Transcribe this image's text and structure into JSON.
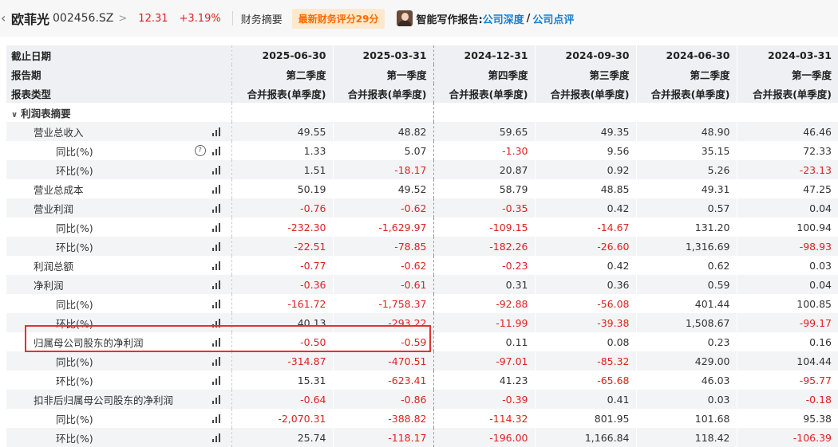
{
  "header": {
    "stock_name": "欧菲光",
    "stock_code": "002456.SZ",
    "chevron": ">",
    "price": "12.31",
    "change": "+3.19%",
    "tab_summary": "财务摘要",
    "score_badge": "最新财务评分29分",
    "report_label": "智能写作报告:",
    "report_link_1": "公司深度",
    "report_slash": "/",
    "report_link_2": "公司点评"
  },
  "table": {
    "header_labels": [
      "截止日期",
      "报告期",
      "报表类型"
    ],
    "columns": [
      {
        "date": "2025-06-30",
        "period": "第二季度",
        "type": "合并报表(单季度)"
      },
      {
        "date": "2025-03-31",
        "period": "第一季度",
        "type": "合并报表(单季度)"
      },
      {
        "date": "2024-12-31",
        "period": "第四季度",
        "type": "合并报表(单季度)"
      },
      {
        "date": "2024-09-30",
        "period": "第三季度",
        "type": "合并报表(单季度)"
      },
      {
        "date": "2024-06-30",
        "period": "第二季度",
        "type": "合并报表(单季度)"
      },
      {
        "date": "2024-03-31",
        "period": "第一季度",
        "type": "合并报表(单季度)"
      }
    ],
    "section_title": "利润表摘要",
    "rows": [
      {
        "label": "营业总收入",
        "values": [
          "49.55",
          "48.82",
          "59.65",
          "49.35",
          "48.90",
          "46.46"
        ]
      },
      {
        "label": "同比(%)",
        "values": [
          "1.33",
          "5.07",
          "-1.30",
          "9.56",
          "35.15",
          "72.33"
        ]
      },
      {
        "label": "环比(%)",
        "values": [
          "1.51",
          "-18.17",
          "20.87",
          "0.92",
          "5.26",
          "-23.13"
        ]
      },
      {
        "label": "营业总成本",
        "values": [
          "50.19",
          "49.52",
          "58.79",
          "48.85",
          "49.31",
          "47.25"
        ]
      },
      {
        "label": "营业利润",
        "values": [
          "-0.76",
          "-0.62",
          "-0.35",
          "0.42",
          "0.57",
          "0.04"
        ]
      },
      {
        "label": "同比(%)",
        "values": [
          "-232.30",
          "-1,629.97",
          "-109.15",
          "-14.67",
          "131.20",
          "100.94"
        ]
      },
      {
        "label": "环比(%)",
        "values": [
          "-22.51",
          "-78.85",
          "-182.26",
          "-26.60",
          "1,316.69",
          "-98.93"
        ]
      },
      {
        "label": "利润总额",
        "values": [
          "-0.77",
          "-0.62",
          "-0.23",
          "0.42",
          "0.62",
          "0.03"
        ]
      },
      {
        "label": "净利润",
        "values": [
          "-0.36",
          "-0.61",
          "0.31",
          "0.36",
          "0.59",
          "0.04"
        ]
      },
      {
        "label": "同比(%)",
        "values": [
          "-161.72",
          "-1,758.37",
          "-92.88",
          "-56.08",
          "401.44",
          "100.85"
        ]
      },
      {
        "label": "环比(%)",
        "values": [
          "40.13",
          "-293.22",
          "-11.99",
          "-39.38",
          "1,508.67",
          "-99.17"
        ]
      },
      {
        "label": "归属母公司股东的净利润",
        "values": [
          "-0.50",
          "-0.59",
          "0.11",
          "0.08",
          "0.23",
          "0.16"
        ]
      },
      {
        "label": "同比(%)",
        "values": [
          "-314.87",
          "-470.51",
          "-97.01",
          "-85.32",
          "429.00",
          "104.44"
        ]
      },
      {
        "label": "环比(%)",
        "values": [
          "15.31",
          "-623.41",
          "41.23",
          "-65.68",
          "46.03",
          "-95.77"
        ]
      },
      {
        "label": "扣非后归属母公司股东的净利润",
        "values": [
          "-0.64",
          "-0.86",
          "-0.39",
          "0.41",
          "0.03",
          "-0.18"
        ]
      },
      {
        "label": "同比(%)",
        "values": [
          "-2,070.31",
          "-388.82",
          "-114.32",
          "801.95",
          "101.68",
          "95.38"
        ]
      },
      {
        "label": "环比(%)",
        "values": [
          "25.74",
          "-118.17",
          "-196.00",
          "1,166.84",
          "118.42",
          "-106.39"
        ]
      }
    ]
  },
  "icons": {
    "help": "?",
    "section_chevron": "∨",
    "back": "‹"
  },
  "colors": {
    "negative": "#e02020",
    "link": "#1a7fd0",
    "badge_text": "#ff6a00",
    "badge_bg": "#ffe8cc",
    "highlight": "#e63030"
  }
}
